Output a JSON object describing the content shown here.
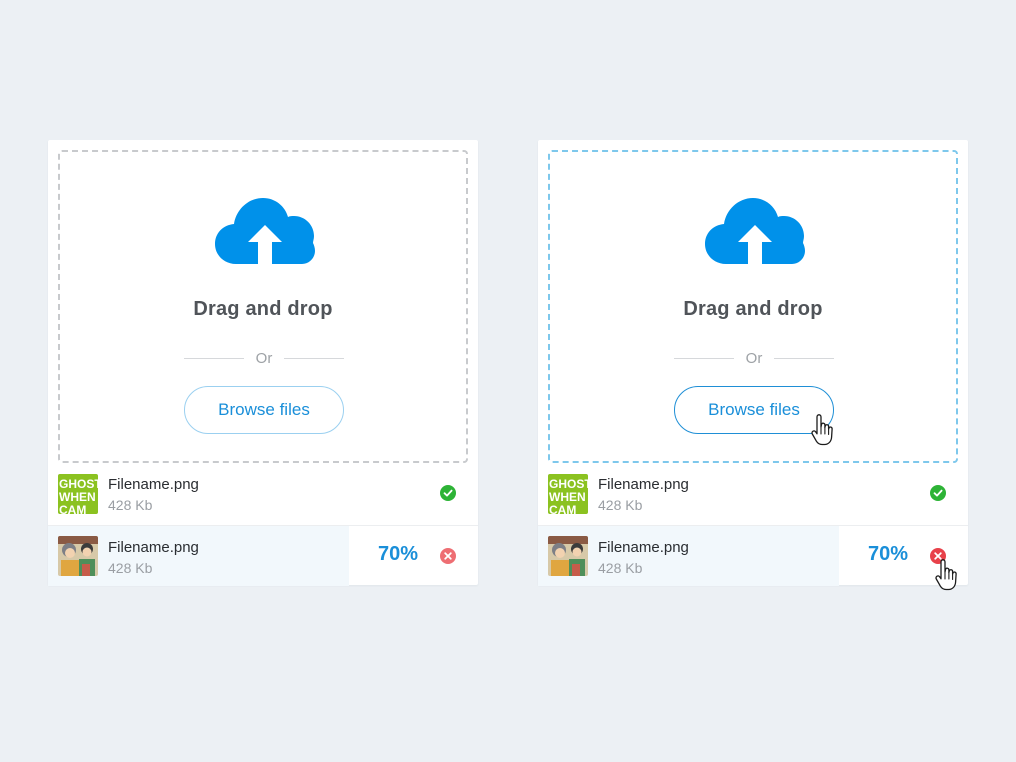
{
  "colors": {
    "accent": "#1a8fd9",
    "cloud": "#0091ea",
    "success": "#2db336",
    "error": "#ee6e73",
    "error_active": "#e8414a",
    "progress_bg": "#f2f8fc"
  },
  "panels": [
    {
      "state": "default",
      "dropzone": {
        "icon": "cloud-upload-icon",
        "title": "Drag and drop",
        "or_text": "Or",
        "browse_label": "Browse files"
      },
      "files": [
        {
          "name": "Filename.png",
          "size": "428 Kb",
          "status": "complete",
          "thumb": "ghost-poster-thumbnail",
          "status_icon": "check-circle-icon"
        },
        {
          "name": "Filename.png",
          "size": "428 Kb",
          "status": "uploading",
          "progress": 70,
          "progress_label": "70%",
          "thumb": "people-illustration-thumbnail",
          "status_icon": "cancel-circle-icon"
        }
      ]
    },
    {
      "state": "hover",
      "dropzone": {
        "icon": "cloud-upload-icon",
        "title": "Drag and drop",
        "or_text": "Or",
        "browse_label": "Browse files"
      },
      "files": [
        {
          "name": "Filename.png",
          "size": "428 Kb",
          "status": "complete",
          "thumb": "ghost-poster-thumbnail",
          "status_icon": "check-circle-icon"
        },
        {
          "name": "Filename.png",
          "size": "428 Kb",
          "status": "uploading",
          "progress": 70,
          "progress_label": "70%",
          "thumb": "people-illustration-thumbnail",
          "status_icon": "cancel-circle-icon"
        }
      ]
    }
  ]
}
